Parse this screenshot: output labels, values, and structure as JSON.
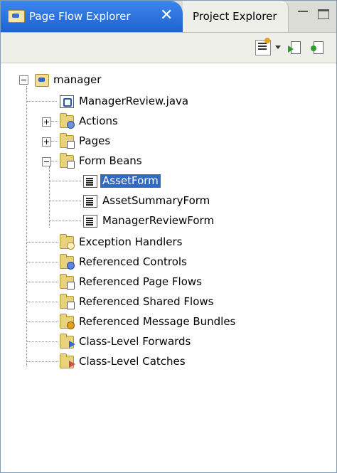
{
  "tabs": {
    "active_label": "Page Flow Explorer",
    "close_glyph": "✕",
    "inactive_label": "Project Explorer"
  },
  "icons": {
    "minimize": "minimize-icon",
    "maximize": "maximize-icon",
    "toolbar": [
      "new-page-flow-icon",
      "dropdown-arrow-icon",
      "run-icon",
      "refresh-icon"
    ]
  },
  "colors": {
    "tab_active": "#2a6fe0",
    "selection": "#316ac5",
    "folder": "#e9d27c"
  },
  "tree": {
    "root": "manager",
    "controller": "ManagerReview.java",
    "actions": "Actions",
    "pages": "Pages",
    "form_beans": "Form Beans",
    "beans": [
      "AssetForm",
      "AssetSummaryForm",
      "ManagerReviewForm"
    ],
    "exception_handlers": "Exception Handlers",
    "referenced_controls": "Referenced Controls",
    "referenced_page_flows": "Referenced Page Flows",
    "referenced_shared_flows": "Referenced Shared Flows",
    "referenced_message_bundles": "Referenced Message Bundles",
    "class_level_forwards": "Class-Level Forwards",
    "class_level_catches": "Class-Level Catches"
  }
}
